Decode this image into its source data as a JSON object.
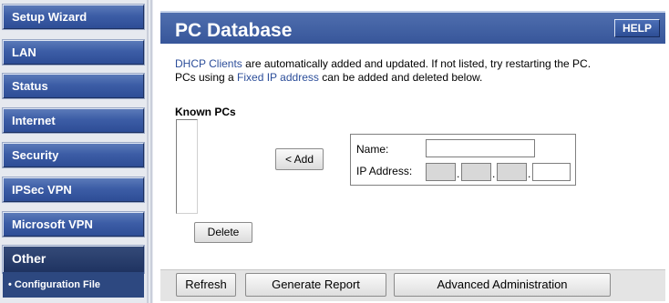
{
  "sidebar": {
    "items": [
      {
        "label": "Setup Wizard"
      },
      {
        "label": "LAN"
      },
      {
        "label": "Status"
      },
      {
        "label": "Internet"
      },
      {
        "label": "Security"
      },
      {
        "label": "IPSec VPN"
      },
      {
        "label": "Microsoft VPN"
      },
      {
        "label": "Other"
      }
    ],
    "sub_item": "• Configuration File"
  },
  "header": {
    "title": "PC Database",
    "help_label": "HELP"
  },
  "intro": {
    "link1": "DHCP Clients",
    "text1": " are automatically added and updated. If not listed, try restarting the PC.",
    "text2": "PCs using a ",
    "link2": "Fixed IP address",
    "text3": " can be added and deleted below."
  },
  "known_pcs": {
    "label": "Known PCs"
  },
  "buttons": {
    "add": "< Add",
    "delete": "Delete"
  },
  "form": {
    "name_label": "Name:",
    "name_value": "",
    "ip_label": "IP Address:",
    "ip_octets": [
      "",
      "",
      "",
      ""
    ],
    "dot": "."
  },
  "bottom_bar": {
    "refresh": "Refresh",
    "generate_report": "Generate Report",
    "advanced_admin": "Advanced Administration"
  }
}
